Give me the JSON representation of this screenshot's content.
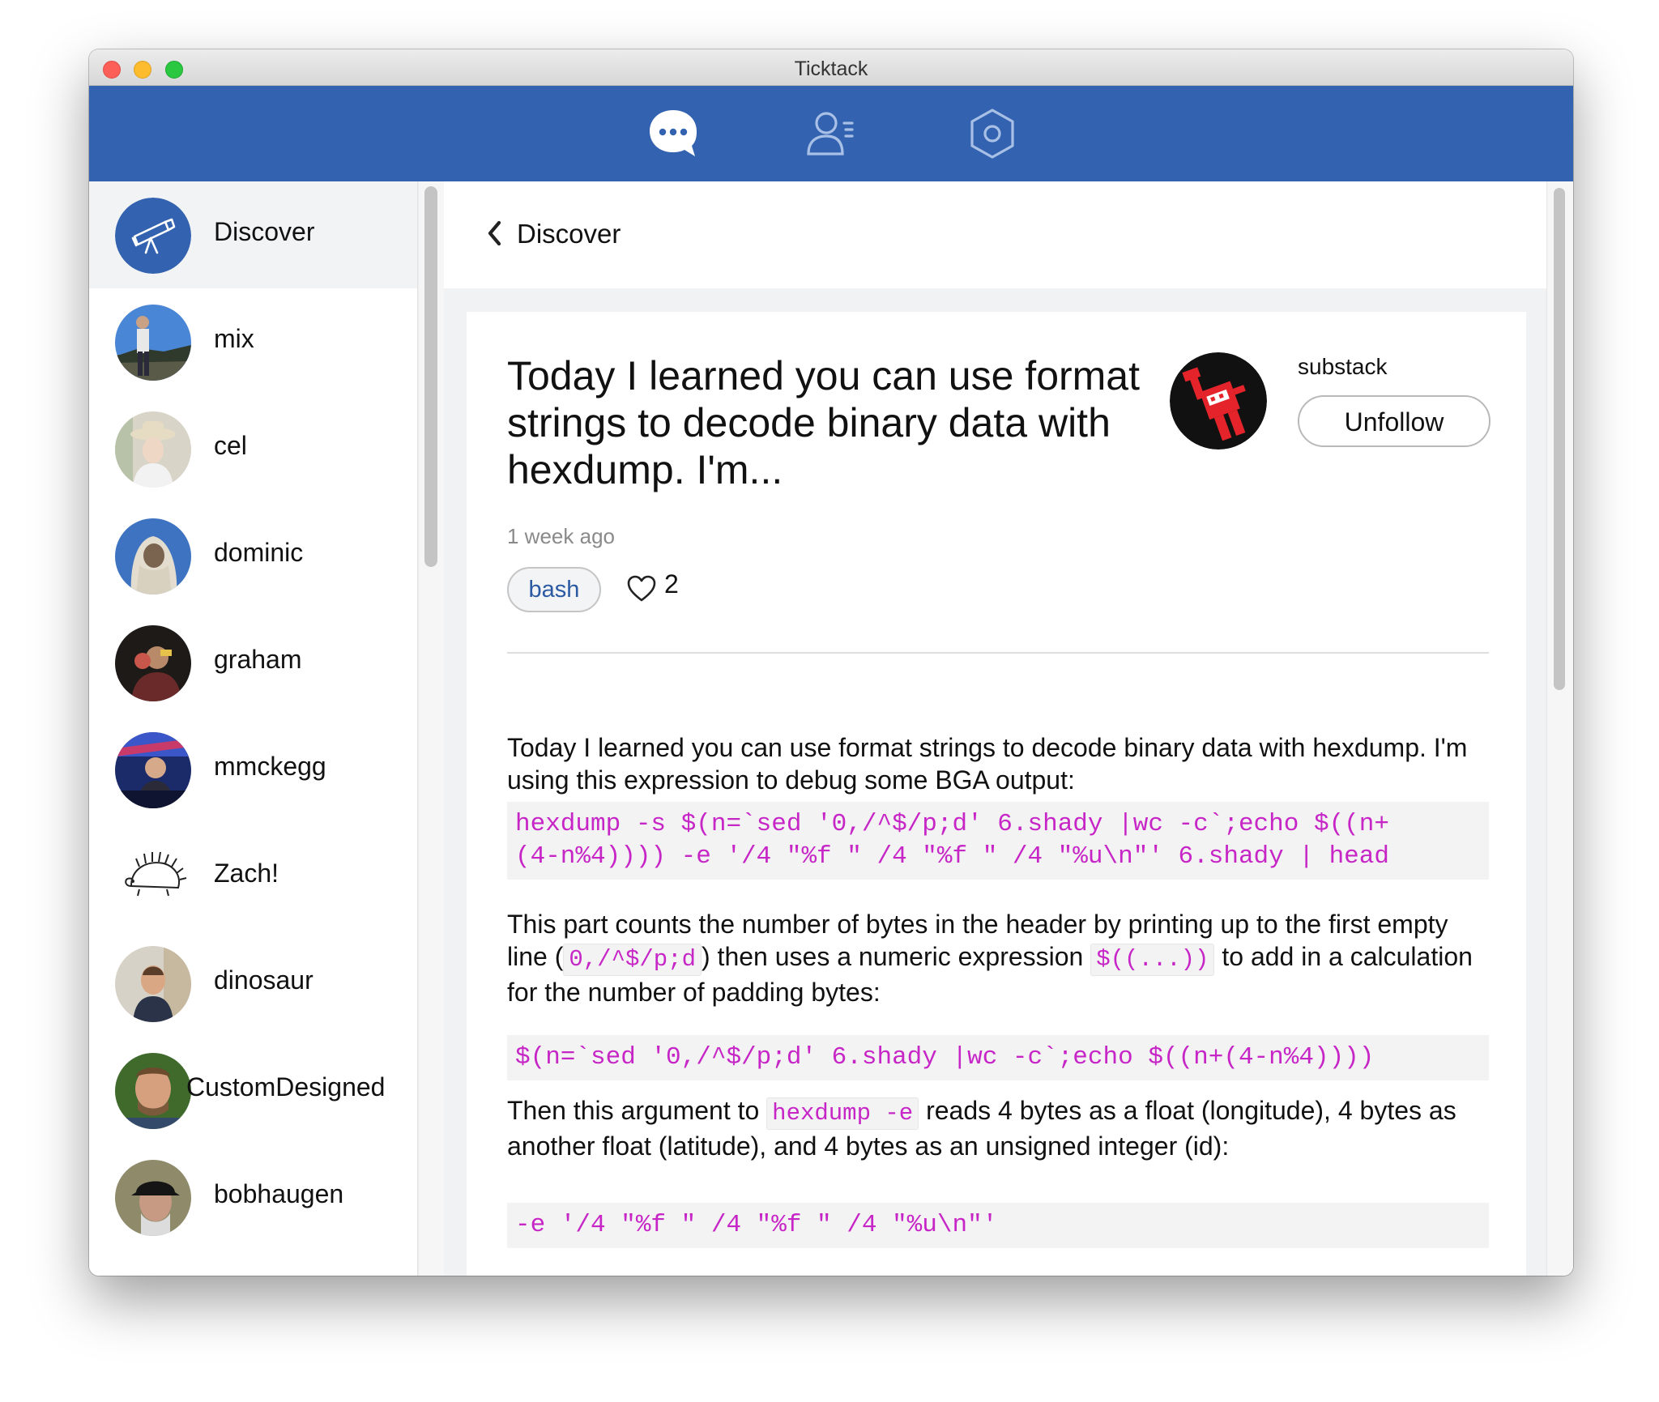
{
  "window": {
    "title": "Ticktack"
  },
  "topnav": {
    "icons": [
      "chat-bubble-icon",
      "people-icon",
      "settings-hexagon-icon"
    ]
  },
  "sidebar": {
    "items": [
      {
        "label": "Discover",
        "icon": "telescope-icon",
        "active": true
      },
      {
        "label": "mix"
      },
      {
        "label": "cel"
      },
      {
        "label": "dominic"
      },
      {
        "label": "graham"
      },
      {
        "label": "mmckegg"
      },
      {
        "label": "Zach!"
      },
      {
        "label": "dinosaur"
      },
      {
        "label": "CustomDesigned"
      },
      {
        "label": "bobhaugen"
      }
    ]
  },
  "main": {
    "back_label": "Discover",
    "post": {
      "title": "Today I learned you can use format strings to decode binary data with hexdump. I'm...",
      "author": "substack",
      "unfollow_label": "Unfollow",
      "timestamp": "1 week ago",
      "tag": "bash",
      "likes": "2",
      "para1": "Today I learned you can use format strings to decode binary data with hexdump. I'm using this expression to debug some BGA output:",
      "code1_line1": "hexdump -s $(n=`sed '0,/^$/p;d' 6.shady |wc -c`;echo $((n+",
      "code1_line2": "(4-n%4)))) -e '/4 \"%f \" /4 \"%f \" /4 \"%u\\n\"' 6.shady | head",
      "para2_a": "This part counts the number of bytes in the header by printing up to the first empty line (",
      "para2_code1": "0,/^$/p;d",
      "para2_b": ") then uses a numeric expression ",
      "para2_code2": "$((...))",
      "para2_c": " to add in a calculation for the number of padding bytes:",
      "code2": "$(n=`sed '0,/^$/p;d' 6.shady |wc -c`;echo $((n+(4-n%4))))",
      "para3_a": "Then this argument to ",
      "para3_code": "hexdump -e",
      "para3_b": " reads 4 bytes as a float (longitude), 4 bytes as another float (latitude), and 4 bytes as an unsigned integer (id):",
      "code3": "-e '/4 \"%f \" /4 \"%f \" /4 \"%u\\n\"'"
    }
  },
  "colors": {
    "accent": "#3363b0",
    "code": "#c726c7",
    "link": "#2b5aa3"
  }
}
